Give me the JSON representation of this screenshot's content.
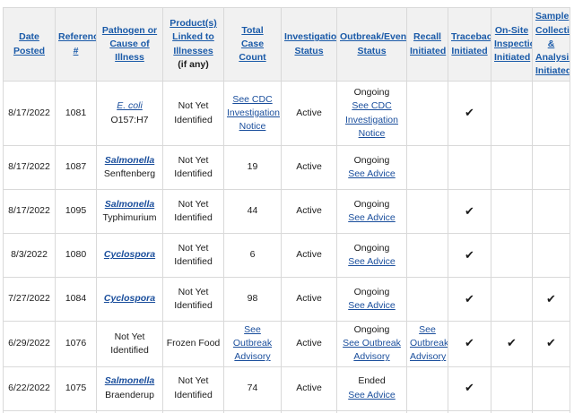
{
  "headers": [
    {
      "lines": [
        "Date",
        "Posted"
      ],
      "note": ""
    },
    {
      "lines": [
        "Reference",
        "#"
      ],
      "note": ""
    },
    {
      "lines": [
        "Pathogen or",
        "Cause of Illness"
      ],
      "note": ""
    },
    {
      "lines": [
        "Product(s)",
        "Linked to",
        "Illnesses"
      ],
      "note": "(if any)"
    },
    {
      "lines": [
        "Total",
        "Case Count"
      ],
      "note": ""
    },
    {
      "lines": [
        "Investigation",
        "Status"
      ],
      "note": ""
    },
    {
      "lines": [
        "Outbreak/Event",
        "Status"
      ],
      "note": ""
    },
    {
      "lines": [
        "Recall",
        "Initiated"
      ],
      "note": ""
    },
    {
      "lines": [
        "Traceback",
        "Initiated"
      ],
      "note": ""
    },
    {
      "lines": [
        "On-Site",
        "Inspection",
        "Initiated"
      ],
      "note": ""
    },
    {
      "lines": [
        "Sample",
        "Collection",
        "&",
        "Analysis",
        "Initiated"
      ],
      "note": ""
    }
  ],
  "check_glyph": "✔",
  "rows": [
    {
      "date": "8/17/2022",
      "ref": "1081",
      "pathogen_italic": "E. coli",
      "pathogen_italic_style": "light",
      "pathogen_rest": "O157:H7",
      "product": "Not Yet Identified",
      "count": "",
      "count_link": [
        "See CDC",
        "Investigation",
        "Notice"
      ],
      "inv_status": "Active",
      "outbreak_status": "Ongoing",
      "outbreak_link": [
        "See CDC",
        "Investigation",
        "Notice"
      ],
      "recall": "",
      "recall_link": [],
      "traceback": true,
      "onsite": false,
      "sample": false
    },
    {
      "date": "8/17/2022",
      "ref": "1087",
      "pathogen_italic": "Salmonella",
      "pathogen_italic_style": "bold",
      "pathogen_rest": "Senftenberg",
      "product": "Not Yet Identified",
      "count": "19",
      "count_link": [],
      "inv_status": "Active",
      "outbreak_status": "Ongoing",
      "outbreak_link": [
        "See Advice"
      ],
      "recall": "",
      "recall_link": [],
      "traceback": false,
      "onsite": false,
      "sample": false
    },
    {
      "date": "8/17/2022",
      "ref": "1095",
      "pathogen_italic": "Salmonella",
      "pathogen_italic_style": "bold",
      "pathogen_rest": "Typhimurium",
      "product": "Not Yet Identified",
      "count": "44",
      "count_link": [],
      "inv_status": "Active",
      "outbreak_status": "Ongoing",
      "outbreak_link": [
        "See Advice"
      ],
      "recall": "",
      "recall_link": [],
      "traceback": true,
      "onsite": false,
      "sample": false
    },
    {
      "date": "8/3/2022",
      "ref": "1080",
      "pathogen_italic": "Cyclospora",
      "pathogen_italic_style": "bold",
      "pathogen_rest": "",
      "product": "Not Yet Identified",
      "count": "6",
      "count_link": [],
      "inv_status": "Active",
      "outbreak_status": "Ongoing",
      "outbreak_link": [
        "See Advice"
      ],
      "recall": "",
      "recall_link": [],
      "traceback": true,
      "onsite": false,
      "sample": false
    },
    {
      "date": "7/27/2022",
      "ref": "1084",
      "pathogen_italic": "Cyclospora",
      "pathogen_italic_style": "bold",
      "pathogen_rest": "",
      "product": "Not Yet Identified",
      "count": "98",
      "count_link": [],
      "inv_status": "Active",
      "outbreak_status": "Ongoing",
      "outbreak_link": [
        "See Advice"
      ],
      "recall": "",
      "recall_link": [],
      "traceback": true,
      "onsite": false,
      "sample": true
    },
    {
      "date": "6/29/2022",
      "ref": "1076",
      "pathogen_italic": "",
      "pathogen_italic_style": "bold",
      "pathogen_rest": "Not Yet Identified",
      "product": "Frozen Food",
      "count": "",
      "count_link": [
        "See Outbreak",
        "Advisory"
      ],
      "inv_status": "Active",
      "outbreak_status": "Ongoing",
      "outbreak_link": [
        "See Outbreak",
        "Advisory"
      ],
      "recall": "",
      "recall_link": [
        "See",
        "Outbreak",
        "Advisory"
      ],
      "traceback": true,
      "onsite": true,
      "sample": true
    },
    {
      "date": "6/22/2022",
      "ref": "1075",
      "pathogen_italic": "Salmonella",
      "pathogen_italic_style": "bold",
      "pathogen_rest": "Braenderup",
      "product": "Not Yet Identified",
      "count": "74",
      "count_link": [],
      "inv_status": "Active",
      "outbreak_status": "Ended",
      "outbreak_link": [
        "See Advice"
      ],
      "recall": "",
      "recall_link": [],
      "traceback": true,
      "onsite": false,
      "sample": false
    }
  ]
}
